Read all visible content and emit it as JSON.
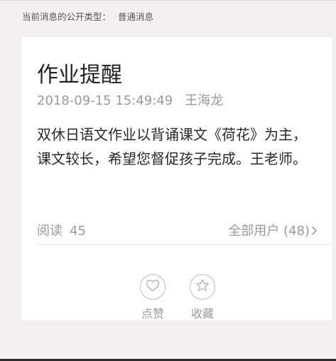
{
  "header": {
    "type_label": "当前消息的公开类型：",
    "type_value": "普通消息"
  },
  "message": {
    "title": "作业提醒",
    "datetime": "2018-09-15 15:49:49",
    "author": "王海龙",
    "content": "双休日语文作业以背诵课文《荷花》为主，课文较长，希望您督促孩子完成。王老师。"
  },
  "stats": {
    "read_label": "阅读",
    "read_count": "45",
    "all_users_label": "全部用户 (48)"
  },
  "actions": {
    "like_label": "点赞",
    "favorite_label": "收藏"
  },
  "colors": {
    "background": "#f3f1ee",
    "card": "#ffffff",
    "muted_text": "#9a9a9a",
    "body_text": "#2a2a2a"
  },
  "icons": {
    "like": "heart-icon",
    "favorite": "star-icon",
    "all_users": "chevron-right-icon"
  }
}
